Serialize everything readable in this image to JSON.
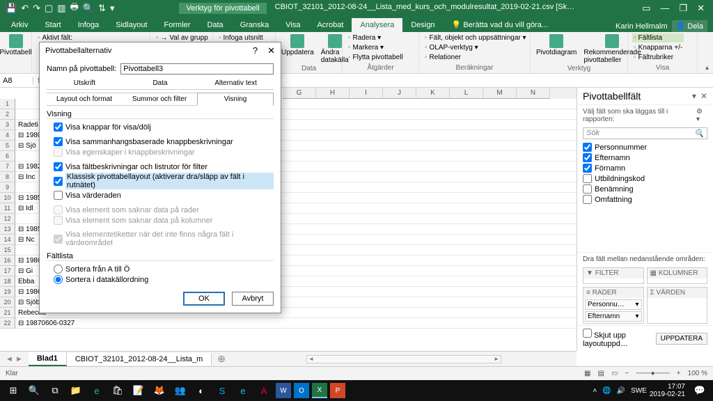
{
  "titlebar": {
    "context_tool": "Verktyg för pivottabell",
    "filename": "CBIOT_32101_2012-08-24__Lista_med_kurs_och_modulresultat_2019-02-21.csv  [Sk…"
  },
  "menutabs": {
    "items": [
      "Arkiv",
      "Start",
      "Infoga",
      "Sidlayout",
      "Formler",
      "Data",
      "Granska",
      "Visa",
      "Acrobat",
      "Analysera",
      "Design"
    ],
    "active": "Analysera",
    "tellme": "Berätta vad du vill göra...",
    "user": "Karin Hellmalm",
    "share": "Dela"
  },
  "ribbon": {
    "g1": {
      "aktivt": "Aktivt fält:",
      "valav": "Val av grupp",
      "insert": "Infoga utsnitt",
      "label": ""
    },
    "pivot": "Pivottabell",
    "uppdatera": "Uppdatera",
    "andra": "Ändra datakälla",
    "data_label": "Data",
    "radera": "Radera",
    "markera": "Markera",
    "flytta": "Flytta pivottabell",
    "atg_label": "Åtgärder",
    "falt": "Fält, objekt och uppsättningar",
    "olap": "OLAP-verktyg",
    "rel": "Relationer",
    "ber_label": "Beräkningar",
    "pivotdiag": "Pivotdiagram",
    "rekom": "Rekommenderade pivottabeller",
    "verktyg_label": "Verktyg",
    "faltlista": "Fältlista",
    "knapp": "Knapparna +/-",
    "rubr": "Fältrubriker",
    "visa_label": "Visa"
  },
  "namebox": "A8",
  "grid": {
    "cols": [
      "G",
      "H",
      "I",
      "J",
      "K",
      "L",
      "M",
      "N"
    ],
    "rows": [
      {
        "n": 1,
        "txt": ""
      },
      {
        "n": 2,
        "txt": ""
      },
      {
        "n": 3,
        "txt": "Radeti"
      },
      {
        "n": 4,
        "txt": "⊟ 1980"
      },
      {
        "n": 5,
        "txt": "  ⊟ Sjö"
      },
      {
        "n": 6,
        "txt": ""
      },
      {
        "n": 7,
        "txt": "⊟ 1982"
      },
      {
        "n": 8,
        "txt": "  ⊟ Inc"
      },
      {
        "n": 9,
        "txt": ""
      },
      {
        "n": 10,
        "txt": "⊟ 1985"
      },
      {
        "n": 11,
        "txt": "  ⊟ Idl"
      },
      {
        "n": 12,
        "txt": ""
      },
      {
        "n": 13,
        "txt": "⊟ 1985"
      },
      {
        "n": 14,
        "txt": "  ⊟ Nc"
      },
      {
        "n": 15,
        "txt": ""
      },
      {
        "n": 16,
        "txt": "⊟ 1986"
      },
      {
        "n": 17,
        "txt": "  ⊟ Gi"
      },
      {
        "n": 18,
        "txt": "    Ebba"
      },
      {
        "n": 19,
        "txt": "⊟ 19861011-4640"
      },
      {
        "n": 20,
        "txt": "  ⊟ Sjöberg"
      },
      {
        "n": 21,
        "txt": "    Rebecca"
      },
      {
        "n": 22,
        "txt": "⊟ 19870606-0327"
      }
    ]
  },
  "dialog": {
    "title": "Pivottabellalternativ",
    "name_label": "Namn på pivottabell:",
    "name_value": "Pivottabell3",
    "tabs_top": [
      "Utskrift",
      "Data",
      "Alternativ text"
    ],
    "tabs_bot": [
      "Layout och format",
      "Summor och filter",
      "Visning"
    ],
    "active_tab": "Visning",
    "sec1": "Visning",
    "c1": "Visa knappar för visa/dölj",
    "c2": "Visa sammanhangsbaserade knappbeskrivningar",
    "c3": "Visa egenskaper i knappbeskrivningar",
    "c4": "Visa fältbeskrivningar och listrutor för filter",
    "c5": "Klassisk pivottabellayout (aktiverar dra/släpp av fält i rutnätet)",
    "c6": "Visa värderaden",
    "c7": "Visa element som saknar data på rader",
    "c8": "Visa element som saknar data på kolumner",
    "c9": "Visa elementetiketter när det inte finns några fält i värdeområdet",
    "sec2": "Fältlista",
    "r1": "Sortera från A till Ö",
    "r2": "Sortera i datakällordning",
    "ok": "OK",
    "cancel": "Avbryt"
  },
  "fieldpanel": {
    "title": "Pivottabellfält",
    "desc": "Välj fält som ska läggas till i rapporten:",
    "search": "Sök",
    "fields": [
      {
        "label": "Personnummer",
        "checked": true
      },
      {
        "label": "Efternamn",
        "checked": true
      },
      {
        "label": "Förnamn",
        "checked": true
      },
      {
        "label": "Utbildningskod",
        "checked": false
      },
      {
        "label": "Benämning",
        "checked": false
      },
      {
        "label": "Omfattning",
        "checked": false
      }
    ],
    "drag": "Dra fält mellan nedanstående områden:",
    "filter": "FILTER",
    "kolumner": "KOLUMNER",
    "rader": "RADER",
    "varden": "VÄRDEN",
    "row_items": [
      "Personnu…",
      "Efternamn"
    ],
    "defer": "Skjut upp layoutuppd…",
    "update": "UPPDATERA"
  },
  "sheets": {
    "active": "Blad1",
    "other": "CBIOT_32101_2012-08-24__Lista_m"
  },
  "status": {
    "left": "Klar",
    "zoom": "100 %"
  },
  "taskbar": {
    "lang": "SWE",
    "time": "17:07",
    "date": "2019-02-21"
  }
}
